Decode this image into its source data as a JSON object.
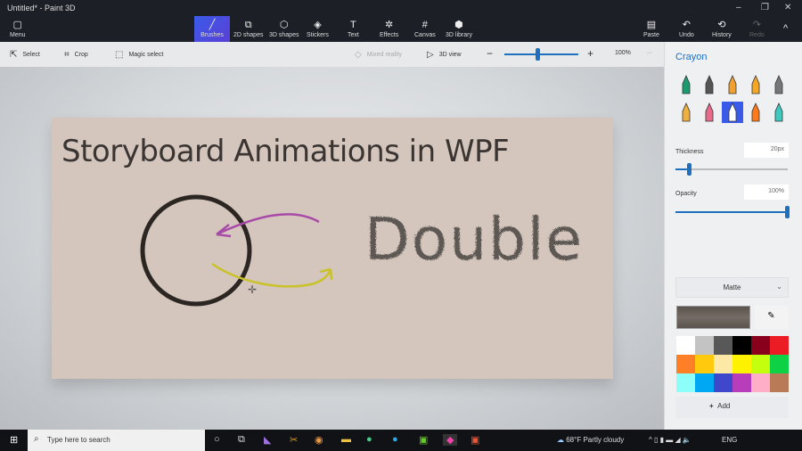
{
  "window": {
    "title": "Untitled* - Paint 3D",
    "minimize": "–",
    "maximize": "❐",
    "close": "✕"
  },
  "ribbon": {
    "menu": "Menu",
    "tabs": [
      "Brushes",
      "2D shapes",
      "3D shapes",
      "Stickers",
      "Text",
      "Effects",
      "Canvas",
      "3D library"
    ],
    "paste": "Paste",
    "undo": "Undo",
    "history": "History",
    "redo": "Redo",
    "collapse": "^"
  },
  "subbar": {
    "select": "Select",
    "crop": "Crop",
    "magic_select": "Magic select",
    "mixed_reality": "Mixed reality",
    "view3d": "3D view",
    "zoom": "100%",
    "zoom_fraction": 0.45,
    "more": "···"
  },
  "canvas": {
    "title": "Storyboard Animations in WPF",
    "handwriting": "Double"
  },
  "panel": {
    "title": "Crayon",
    "thickness_label": "Thickness",
    "thickness_value": "20px",
    "thickness_fraction": 0.12,
    "opacity_label": "Opacity",
    "opacity_value": "100%",
    "opacity_fraction": 1.0,
    "finish": "Matte",
    "add_label": "Add",
    "palette": [
      "#ffffff",
      "#c3c3c3",
      "#585858",
      "#000000",
      "#88001b",
      "#ec1c24",
      "#ff7f27",
      "#ffc90e",
      "#fde8a5",
      "#fff200",
      "#c4ff0e",
      "#0ed145",
      "#8cfffb",
      "#00a8f3",
      "#3f48cc",
      "#b83dba",
      "#ffaec8",
      "#b97a57"
    ],
    "brush_colors": [
      "#1a9c6e",
      "#555",
      "#f0a030",
      "#f5a623",
      "#777",
      "#f0b040",
      "#e86a8a",
      "#3a5be8",
      "#ff7a1a",
      "#3ec9c0"
    ]
  },
  "taskbar": {
    "search_placeholder": "Type here to search",
    "weather": "68°F  Partly cloudy",
    "lang": "ENG"
  }
}
